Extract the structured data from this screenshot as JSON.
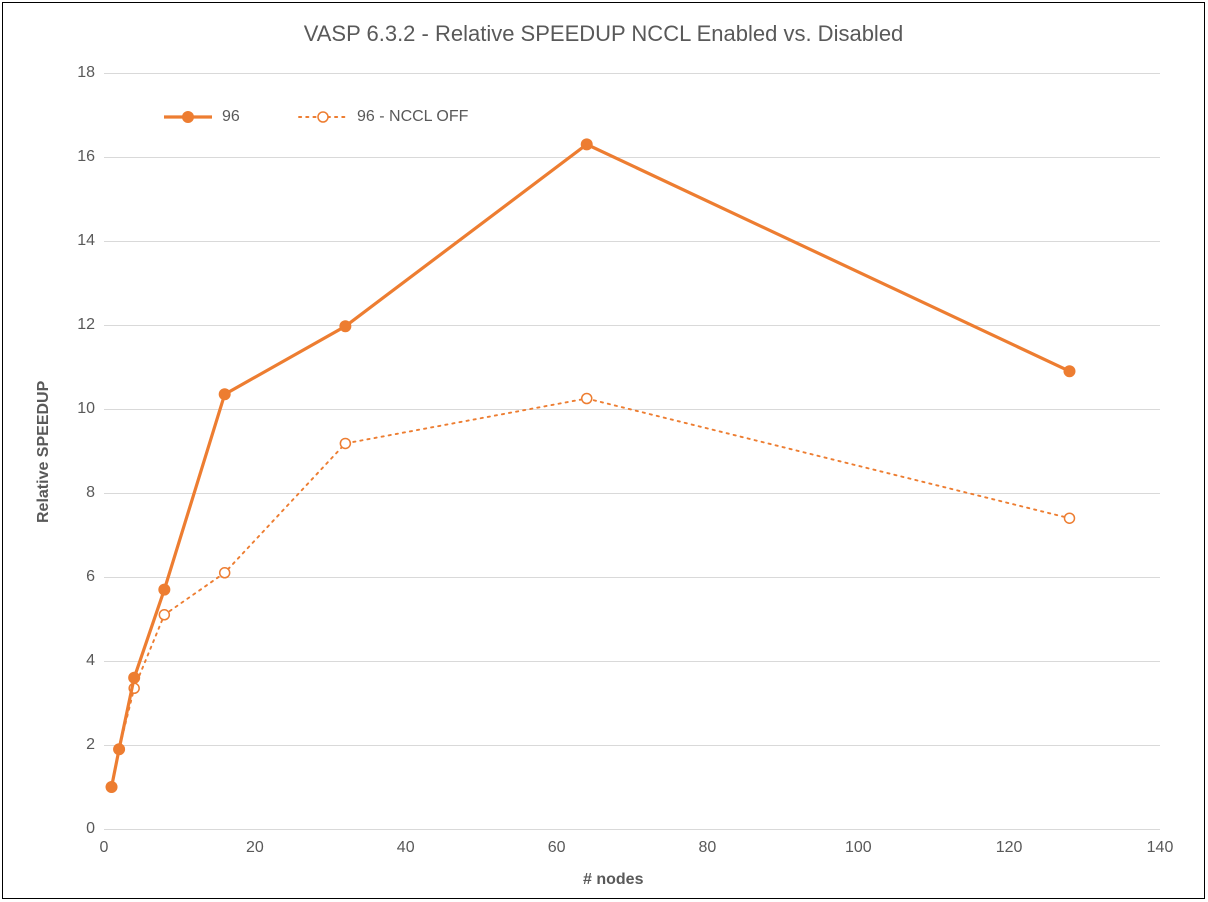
{
  "title": "VASP 6.3.2 - Relative SPEEDUP NCCL Enabled vs. Disabled",
  "xlabel": "# nodes",
  "ylabel": "Relative SPEEDUP",
  "legend": {
    "s1": "96",
    "s2": "96 - NCCL OFF"
  },
  "xticks": {
    "t0": "0",
    "t1": "20",
    "t2": "40",
    "t3": "60",
    "t4": "80",
    "t5": "100",
    "t6": "120",
    "t7": "140"
  },
  "yticks": {
    "t0": "0",
    "t1": "2",
    "t2": "4",
    "t3": "6",
    "t4": "8",
    "t5": "10",
    "t6": "12",
    "t7": "14",
    "t8": "16",
    "t9": "18"
  },
  "chart_data": {
    "type": "line",
    "title": "VASP 6.3.2 - Relative SPEEDUP NCCL Enabled vs. Disabled",
    "xlabel": "# nodes",
    "ylabel": "Relative SPEEDUP",
    "xlim": [
      0,
      140
    ],
    "ylim": [
      0,
      18
    ],
    "x": [
      1,
      2,
      4,
      8,
      16,
      32,
      64,
      128
    ],
    "series": [
      {
        "name": "96",
        "values": [
          1.0,
          1.9,
          3.6,
          5.7,
          10.35,
          11.97,
          16.3,
          10.9
        ],
        "style": "solid",
        "marker": "filled"
      },
      {
        "name": "96 - NCCL OFF",
        "values": [
          1.0,
          1.9,
          3.35,
          5.1,
          6.1,
          9.18,
          10.25,
          7.4
        ],
        "style": "dotted",
        "marker": "open"
      }
    ],
    "legend_position": "top-left",
    "grid": {
      "x": false,
      "y": true
    }
  },
  "colors": {
    "accent": "#ED7D31",
    "grid": "#D9D9D9",
    "text": "#595959"
  }
}
